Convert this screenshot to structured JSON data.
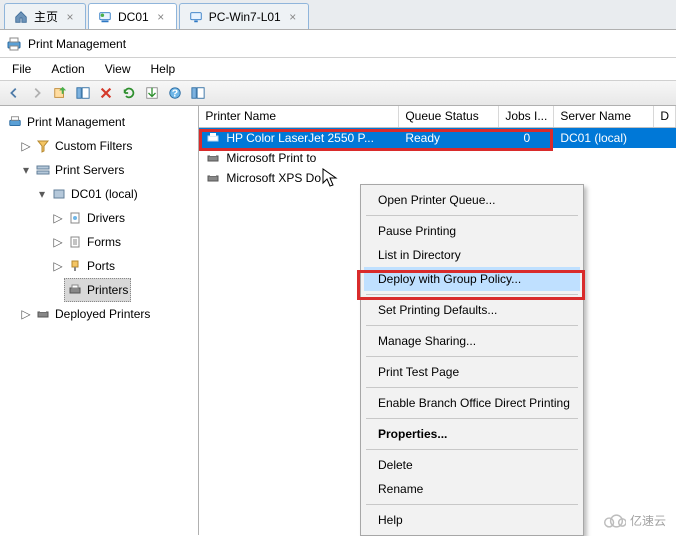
{
  "tabs": [
    {
      "label": "主页",
      "active": false
    },
    {
      "label": "DC01",
      "active": true
    },
    {
      "label": "PC-Win7-L01",
      "active": false
    }
  ],
  "app_title": "Print Management",
  "menu": {
    "file": "File",
    "action": "Action",
    "view": "View",
    "help": "Help"
  },
  "tree": {
    "root": "Print Management",
    "custom_filters": "Custom Filters",
    "print_servers": "Print Servers",
    "server": "DC01 (local)",
    "drivers": "Drivers",
    "forms": "Forms",
    "ports": "Ports",
    "printers": "Printers",
    "deployed": "Deployed Printers"
  },
  "columns": {
    "name": "Printer Name",
    "queue": "Queue Status",
    "jobs": "Jobs I...",
    "server": "Server Name",
    "d": "D"
  },
  "rows": [
    {
      "name": "HP Color LaserJet 2550 P...",
      "queue": "Ready",
      "jobs": "0",
      "server": "DC01 (local)",
      "selected": true
    },
    {
      "name": "Microsoft Print to",
      "queue": "",
      "jobs": "",
      "server": "",
      "selected": false
    },
    {
      "name": "Microsoft XPS Do",
      "queue": "",
      "jobs": "",
      "server": "",
      "selected": false
    }
  ],
  "context_menu": {
    "open_queue": "Open Printer Queue...",
    "pause": "Pause Printing",
    "list_dir": "List in Directory",
    "deploy_gp": "Deploy with Group Policy...",
    "defaults": "Set Printing Defaults...",
    "sharing": "Manage Sharing...",
    "test_page": "Print Test Page",
    "branch": "Enable Branch Office Direct Printing",
    "properties": "Properties...",
    "delete": "Delete",
    "rename": "Rename",
    "help": "Help"
  },
  "watermark": "亿速云"
}
